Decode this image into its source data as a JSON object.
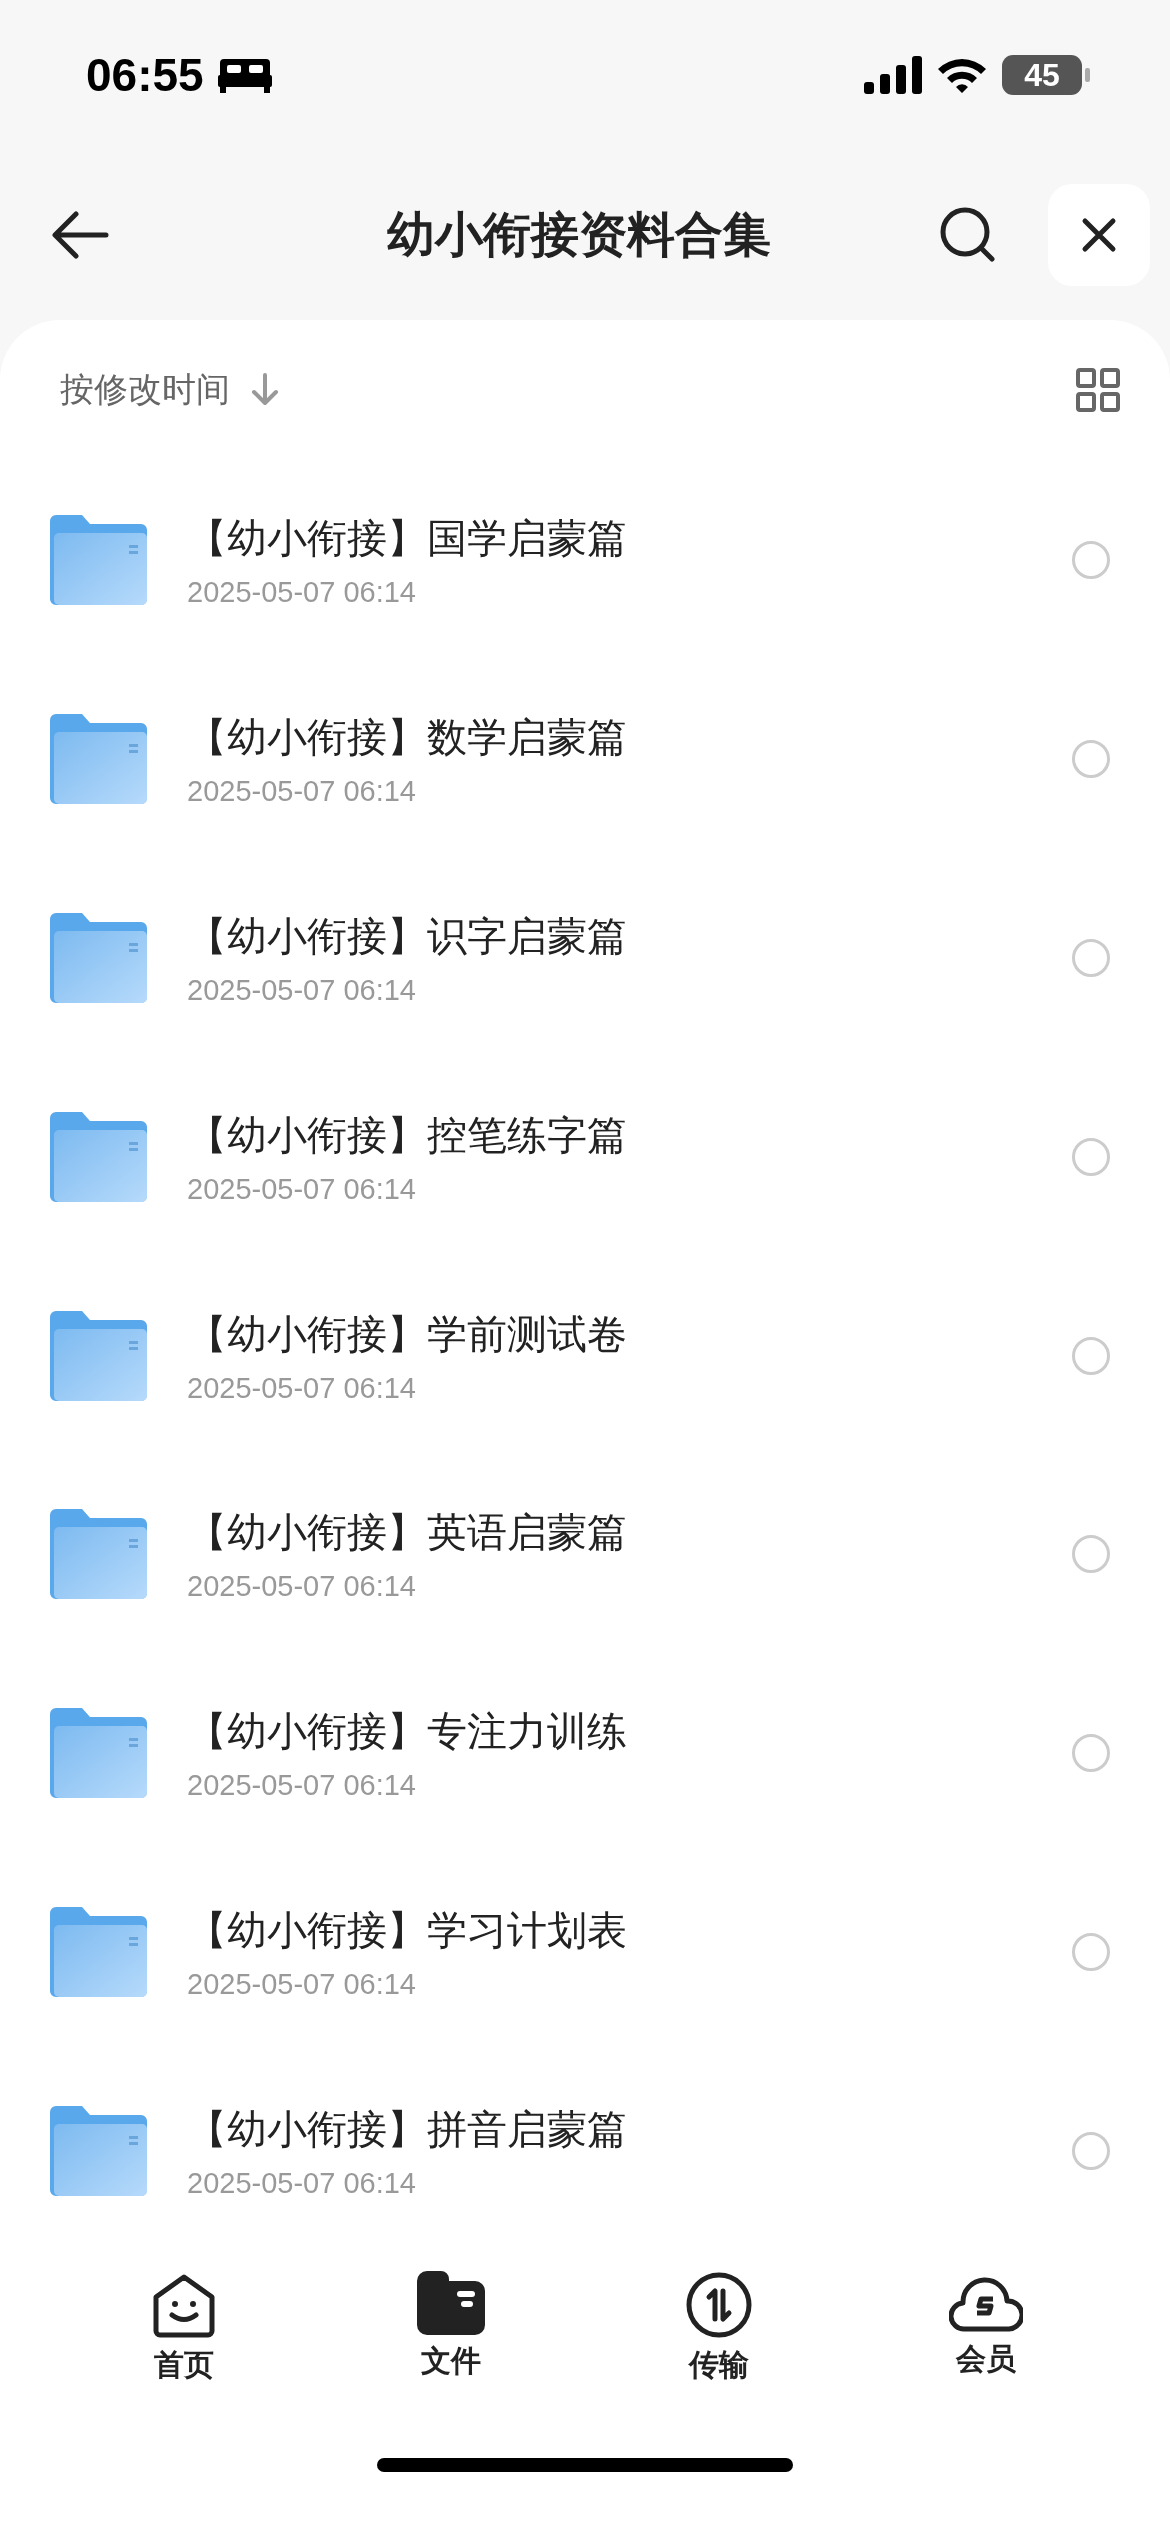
{
  "status_bar": {
    "time": "06:55",
    "battery": "45"
  },
  "header": {
    "title": "幼小衔接资料合集"
  },
  "sort": {
    "label": "按修改时间"
  },
  "files": [
    {
      "name": "【幼小衔接】国学启蒙篇",
      "date": "2025-05-07 06:14",
      "checked": false
    },
    {
      "name": "【幼小衔接】数学启蒙篇",
      "date": "2025-05-07 06:14",
      "checked": false
    },
    {
      "name": "【幼小衔接】识字启蒙篇",
      "date": "2025-05-07 06:14",
      "checked": false
    },
    {
      "name": "【幼小衔接】控笔练字篇",
      "date": "2025-05-07 06:14",
      "checked": false
    },
    {
      "name": "【幼小衔接】学前测试卷",
      "date": "2025-05-07 06:14",
      "checked": false
    },
    {
      "name": "【幼小衔接】英语启蒙篇",
      "date": "2025-05-07 06:14",
      "checked": false
    },
    {
      "name": "【幼小衔接】专注力训练",
      "date": "2025-05-07 06:14",
      "checked": false
    },
    {
      "name": "【幼小衔接】学习计划表",
      "date": "2025-05-07 06:14",
      "checked": false
    },
    {
      "name": "【幼小衔接】拼音启蒙篇",
      "date": "2025-05-07 06:14",
      "checked": false
    }
  ],
  "tab_bar": [
    {
      "kind": "home",
      "label": "首页",
      "selected": false
    },
    {
      "kind": "files",
      "label": "文件",
      "selected": true
    },
    {
      "kind": "transfer",
      "label": "传输",
      "selected": false
    },
    {
      "kind": "vip",
      "label": "会员",
      "selected": false
    }
  ]
}
